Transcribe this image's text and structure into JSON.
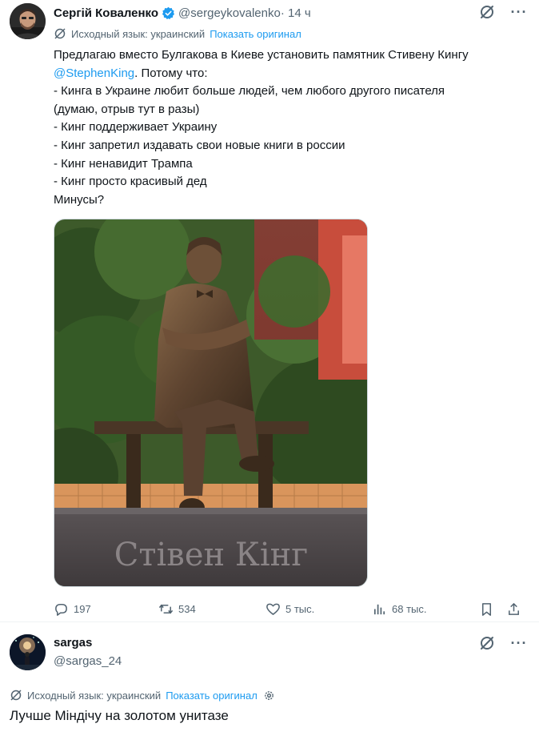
{
  "post": {
    "author_name": "Сергій Коваленко",
    "handle": "@sergeykovalenko",
    "time": " · 14 ч",
    "translation": {
      "label": "Исходный язык: украинский",
      "show_original": "Показать оригинал"
    },
    "text_lines": [
      "Предлагаю вместо Булгакова в Киеве установить памятник Стивену Кингу",
      "@StephenKing",
      ". Потому что:",
      "- Кинга в Украине любит больше людей, чем любого другого писателя",
      "(думаю, отрыв тут в разы)",
      "- Кинг поддерживает Украину",
      "- Кинг запретил издавать свои новые книги в россии",
      "- Кинг ненавидит Трампа",
      "- Кинг просто красивый дед",
      "Минусы?"
    ],
    "image": {
      "inscription": "Стівен Кінг"
    },
    "stats": {
      "replies": "197",
      "reposts": "534",
      "likes": "5 тыс.",
      "views": "68 тыс."
    }
  },
  "reply": {
    "author_name": "sargas",
    "handle": "@sargas_24",
    "translation": {
      "label": "Исходный язык: украинский",
      "show_original": "Показать оригинал"
    },
    "text": "Лучше Міндічу на золотом унитазе"
  },
  "colors": {
    "accent": "#1d9bf0",
    "secondary_text": "#536471",
    "primary_text": "#0f1419"
  },
  "icons": [
    "verified-badge-icon",
    "grok-icon",
    "more-icon",
    "translate-icon",
    "reply-icon",
    "repost-icon",
    "like-icon",
    "views-icon",
    "bookmark-icon",
    "share-icon",
    "gear-icon"
  ]
}
